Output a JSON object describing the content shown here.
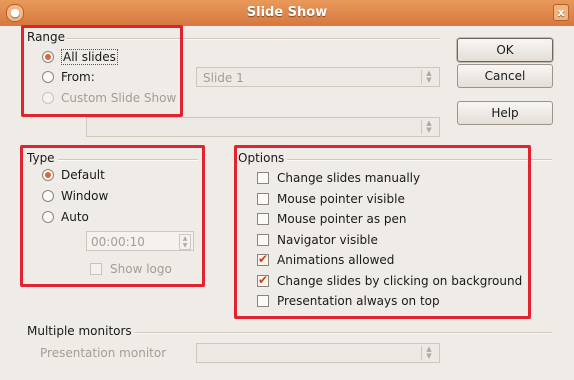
{
  "window": {
    "title": "Slide Show",
    "close_glyph": "x"
  },
  "range": {
    "title": "Range",
    "all_slides": "All slides",
    "from": "From:",
    "from_value": "Slide 1",
    "custom": "Custom Slide Show",
    "custom_value": "",
    "selected": "all_slides"
  },
  "type": {
    "title": "Type",
    "default": "Default",
    "window": "Window",
    "auto": "Auto",
    "auto_time": "00:00:10",
    "show_logo": "Show logo",
    "selected": "default"
  },
  "options": {
    "title": "Options",
    "items": [
      {
        "label": "Change slides manually",
        "checked": false
      },
      {
        "label": "Mouse pointer visible",
        "checked": false
      },
      {
        "label": "Mouse pointer as pen",
        "checked": false
      },
      {
        "label": "Navigator visible",
        "checked": false
      },
      {
        "label": "Animations allowed",
        "checked": true
      },
      {
        "label": "Change slides by clicking on background",
        "checked": true
      },
      {
        "label": "Presentation always on top",
        "checked": false
      }
    ]
  },
  "monitors": {
    "title": "Multiple monitors",
    "presentation_monitor": "Presentation monitor",
    "monitor_value": ""
  },
  "buttons": {
    "ok": "OK",
    "cancel": "Cancel",
    "help": "Help"
  },
  "colors": {
    "highlight_box": "#e0232e",
    "titlebar": "#d7773f",
    "radio_dot": "#d8673a"
  }
}
